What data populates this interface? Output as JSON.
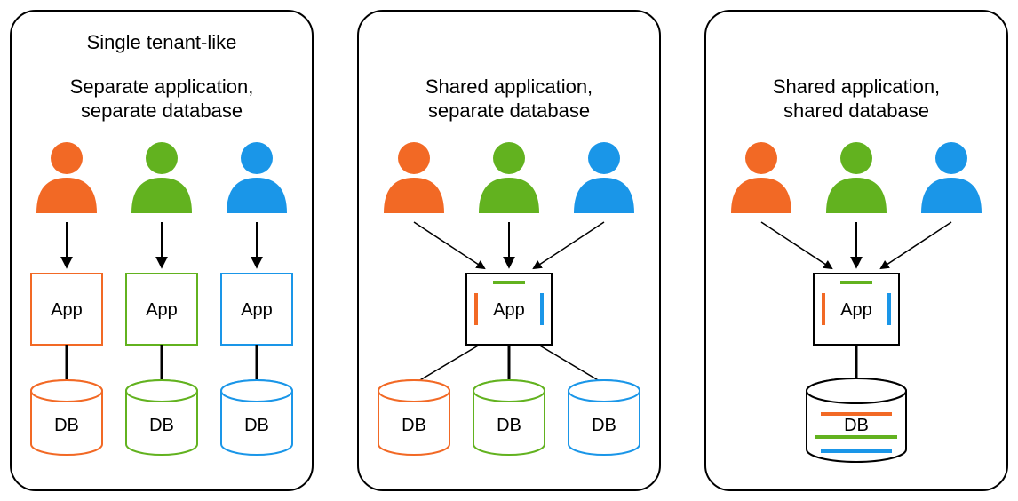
{
  "colors": {
    "orange": "#f26925",
    "green": "#62b21f",
    "blue": "#1a96e8",
    "black": "#000000"
  },
  "labels": {
    "app": "App",
    "db": "DB"
  },
  "panels": [
    {
      "id": "separate-app-separate-db",
      "title_line1": "Single tenant-like",
      "title_line2": "Separate application,",
      "title_line3": "separate database",
      "tenants": [
        "orange",
        "green",
        "blue"
      ],
      "apps": [
        "orange",
        "green",
        "blue"
      ],
      "dbs": [
        "orange",
        "green",
        "blue"
      ]
    },
    {
      "id": "shared-app-separate-db",
      "title_line1": "",
      "title_line2": "Shared application,",
      "title_line3": "separate database",
      "tenants": [
        "orange",
        "green",
        "blue"
      ],
      "apps": [
        "shared"
      ],
      "dbs": [
        "orange",
        "green",
        "blue"
      ]
    },
    {
      "id": "shared-app-shared-db",
      "title_line1": "",
      "title_line2": "Shared application,",
      "title_line3": "shared database",
      "tenants": [
        "orange",
        "green",
        "blue"
      ],
      "apps": [
        "shared"
      ],
      "dbs": [
        "shared"
      ]
    }
  ]
}
